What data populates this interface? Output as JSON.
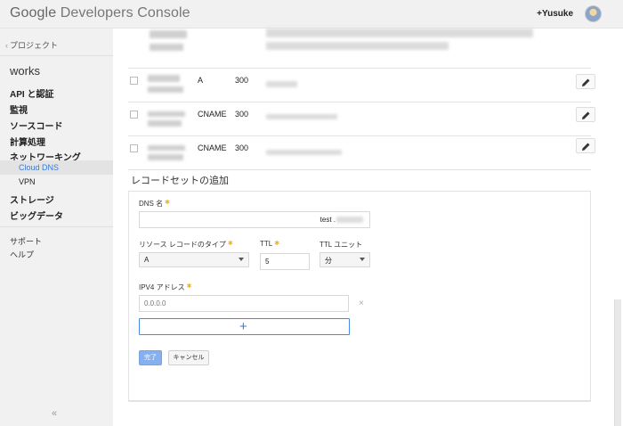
{
  "header": {
    "logo_google": "Google",
    "logo_product": "Developers Console",
    "user_name": "+Yusuke"
  },
  "sidebar": {
    "back_label": "プロジェクト",
    "project_name": "works",
    "items": [
      {
        "label": "API と認証"
      },
      {
        "label": "監視"
      },
      {
        "label": "ソースコード"
      },
      {
        "label": "計算処理"
      },
      {
        "label": "ネットワーキング"
      },
      {
        "label": "Cloud DNS"
      },
      {
        "label": "VPN"
      },
      {
        "label": "ストレージ"
      },
      {
        "label": "ビッグデータ"
      },
      {
        "label": "サポート"
      },
      {
        "label": "ヘルプ"
      }
    ],
    "collapse_icon": "«"
  },
  "records": [
    {
      "type": "",
      "ttl": ""
    },
    {
      "type": "A",
      "ttl": "300"
    },
    {
      "type": "CNAME",
      "ttl": "300"
    },
    {
      "type": "CNAME",
      "ttl": "300"
    }
  ],
  "form": {
    "section_title": "レコードセットの追加",
    "dns_name_label": "DNS 名",
    "dns_name_suffix": "test .",
    "record_type_label": "リソース レコードのタイプ",
    "record_type_value": "A",
    "ttl_label": "TTL",
    "ttl_value": "5",
    "ttl_unit_label": "TTL ユニット",
    "ttl_unit_value": "分",
    "ipv4_label": "IPV4 アドレス",
    "ipv4_placeholder": "0.0.0.0",
    "add_icon": "+",
    "remove_icon": "×",
    "done_label": "完了",
    "cancel_label": "キャンセル"
  },
  "colors": {
    "accent": "#3a7bd5",
    "done_button": "#86b1f0",
    "required_star": "#f2b01e"
  }
}
